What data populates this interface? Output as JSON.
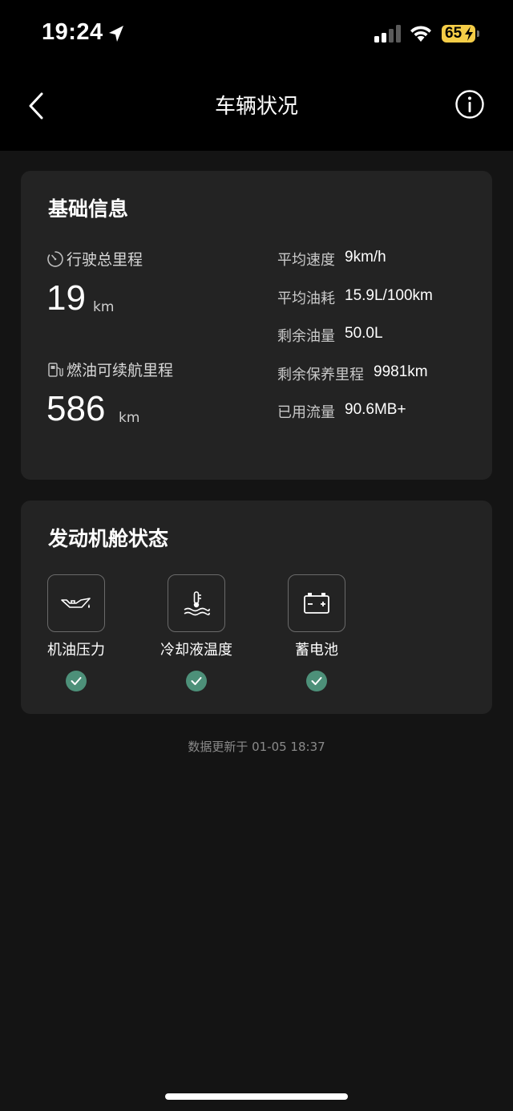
{
  "status_bar": {
    "time": "19:24",
    "battery": "65",
    "icons": [
      "location-arrow-icon",
      "cellular-signal-icon",
      "wifi-icon",
      "battery-charging-icon"
    ]
  },
  "nav": {
    "title": "车辆状况",
    "back_icon": "chevron-left-icon",
    "info_icon": "info-circle-icon"
  },
  "basic_info": {
    "title": "基础信息",
    "odometer": {
      "label": "行驶总里程",
      "value": "19",
      "unit": "km",
      "icon": "odometer-icon"
    },
    "fuel_range": {
      "label": "燃油可续航里程",
      "value": "586",
      "unit": "km",
      "icon": "fuel-pump-icon"
    },
    "stats": [
      {
        "key": "平均速度",
        "value": "9km/h"
      },
      {
        "key": "平均油耗",
        "value": "15.9L/100km"
      },
      {
        "key": "剩余油量",
        "value": "50.0L"
      },
      {
        "key": "剩余保养里程",
        "value": "9981km"
      },
      {
        "key": "已用流量",
        "value": "90.6MB+"
      }
    ]
  },
  "engine": {
    "title": "发动机舱状态",
    "items": [
      {
        "label": "机油压力",
        "icon": "oil-can-icon",
        "status": "ok"
      },
      {
        "label": "冷却液温度",
        "icon": "coolant-temperature-icon",
        "status": "ok"
      },
      {
        "label": "蓄电池",
        "icon": "battery-icon",
        "status": "ok"
      }
    ]
  },
  "footer": {
    "update_text": "数据更新于 01-05 18:37"
  },
  "colors": {
    "background": "#141414",
    "card": "#232323",
    "check_ok": "#4d9079",
    "battery_indicator": "#f5cd47"
  }
}
